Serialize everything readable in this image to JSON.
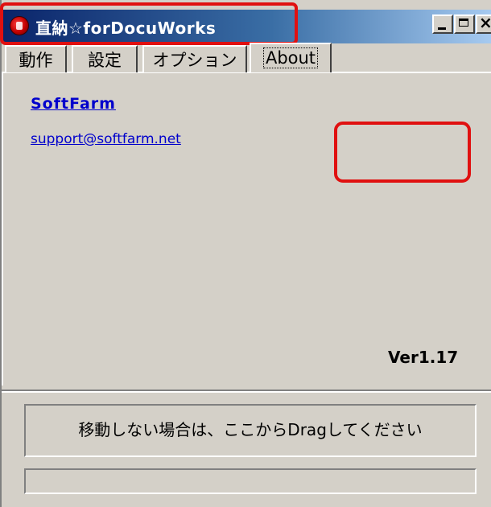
{
  "window": {
    "title": "直納☆forDocuWorks"
  },
  "tabs": [
    {
      "label": "動作",
      "active": false
    },
    {
      "label": "設定",
      "active": false
    },
    {
      "label": "オプション",
      "active": false
    },
    {
      "label": "About",
      "active": true
    }
  ],
  "about": {
    "company_link": "SoftFarm",
    "support_email": "support@softfarm.net",
    "version": "Ver1.17"
  },
  "drag_area": {
    "text": "移動しない場合は、ここからDragしてください"
  },
  "status_bar": {
    "text": ""
  },
  "colors": {
    "titlebar_start": "#0a246a",
    "titlebar_end": "#a6caf0",
    "window_bg": "#d4d0c8",
    "link": "#0000cc",
    "highlight": "#e01010"
  },
  "icons": {
    "app": "app-logo-icon",
    "minimize": "minimize-icon",
    "maximize": "maximize-icon",
    "close": "close-icon"
  }
}
